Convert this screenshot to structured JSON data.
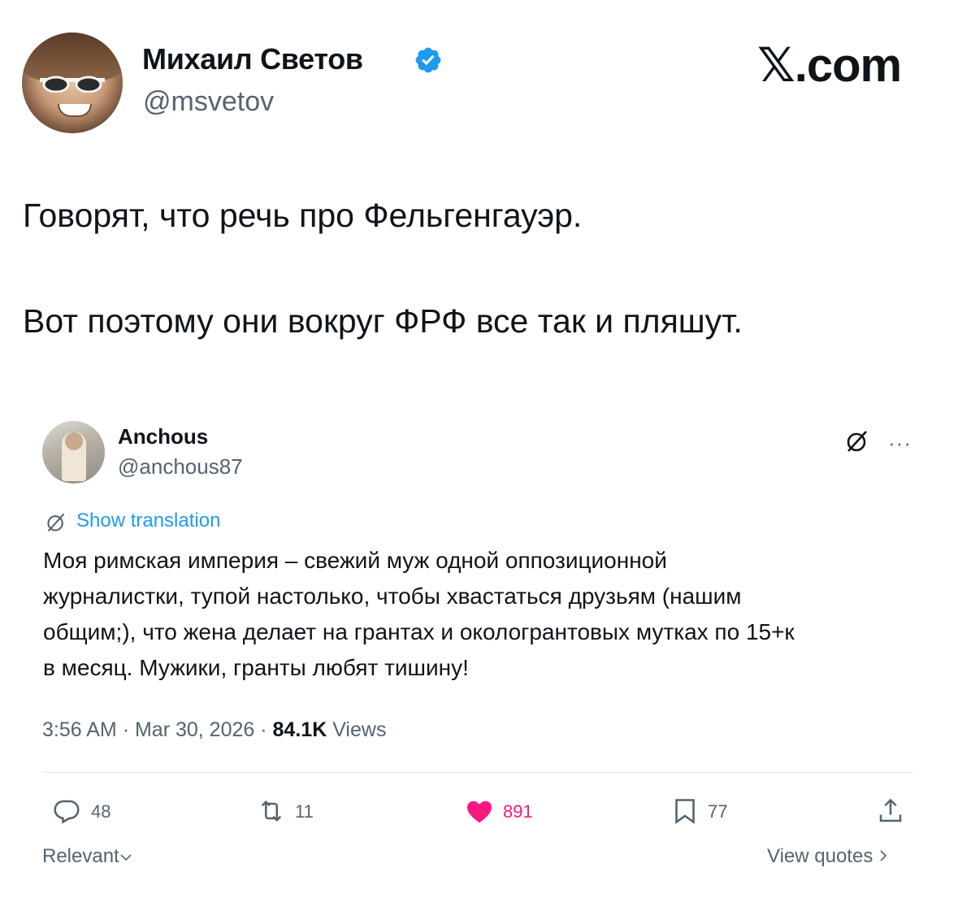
{
  "author": {
    "name": "Михаил Светов",
    "handle": "@msvetov",
    "verified": true
  },
  "site_logo": "𝕏.com",
  "tweet": {
    "lines": [
      "Говорят, что речь про Фельгенгауэр.",
      "Вот поэтому они вокруг ФРФ все так и пляшут."
    ]
  },
  "quoted": {
    "name": "Anchous",
    "handle": "@anchous87",
    "show_translation": "Show translation",
    "lines": [
      "Моя римская империя – свежий муж одной оппозиционной",
      "журналистки, тупой настолько, чтобы хвастаться друзьям (нашим",
      "общим;), что жена делает на грантах и окологрантовых мутках по 15+к",
      "в месяц. Мужики, гранты любят тишину!"
    ],
    "time": "3:56 AM",
    "date": "Mar 30, 2026",
    "views_count": "84.1K",
    "views_label": "Views",
    "stats": {
      "replies": "48",
      "reposts": "11",
      "likes": "891",
      "bookmarks": "77"
    },
    "relevant_label": "Relevant",
    "view_quotes_label": "View quotes"
  },
  "colors": {
    "text": "#0f1419",
    "secondary": "#536471",
    "link": "#1d9bf0",
    "like": "#f91880",
    "verified": "#1d9bf0"
  },
  "icons": [
    "verified-badge-icon",
    "grok-icon",
    "more-icon",
    "translate-icon",
    "reply-icon",
    "repost-icon",
    "like-icon",
    "bookmark-icon",
    "share-icon",
    "chevron-down-icon",
    "chevron-right-icon"
  ]
}
